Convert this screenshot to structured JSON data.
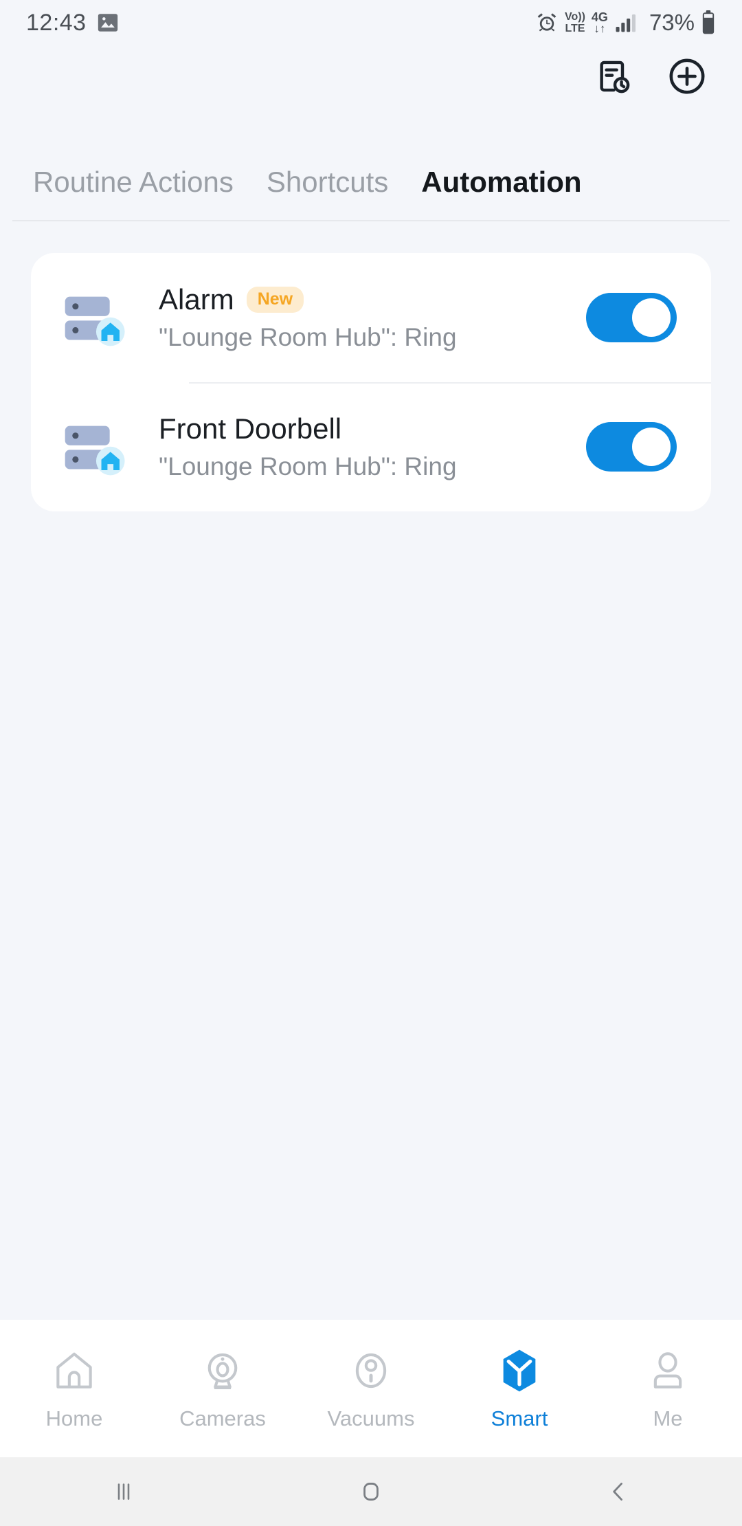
{
  "status_bar": {
    "time": "12:43",
    "battery_percent": "73%",
    "icons": [
      "image-icon",
      "alarm-icon",
      "volte-icon",
      "4g-icon",
      "signal-icon",
      "battery-icon"
    ],
    "volte_top": "Vo))",
    "volte_bottom": "LTE",
    "network_type": "4G",
    "network_arrows": "↓↑"
  },
  "header": {
    "actions": [
      {
        "name": "history-log-icon",
        "label": "Log"
      },
      {
        "name": "add-icon",
        "label": "Add"
      }
    ]
  },
  "tabs": [
    {
      "label": "Routine Actions",
      "active": false
    },
    {
      "label": "Shortcuts",
      "active": false
    },
    {
      "label": "Automation",
      "active": true
    }
  ],
  "automations": [
    {
      "title": "Alarm",
      "badge": "New",
      "subtitle": "\"Lounge Room Hub\": Ring",
      "icon": "hub-device-icon",
      "enabled": true,
      "toggle_state": "on"
    },
    {
      "title": "Front Doorbell",
      "badge": "",
      "subtitle": "\"Lounge Room Hub\": Ring",
      "icon": "hub-device-icon",
      "enabled": true,
      "toggle_state": "on"
    }
  ],
  "bottom_nav": [
    {
      "label": "Home",
      "icon": "home-icon",
      "active": false
    },
    {
      "label": "Cameras",
      "icon": "camera-icon",
      "active": false
    },
    {
      "label": "Vacuums",
      "icon": "vacuum-icon",
      "active": false
    },
    {
      "label": "Smart",
      "icon": "smart-cube-icon",
      "active": true
    },
    {
      "label": "Me",
      "icon": "person-icon",
      "active": false
    }
  ],
  "system_nav": [
    {
      "name": "recents-button",
      "icon": "recents-icon"
    },
    {
      "name": "home-button",
      "icon": "home-square-icon"
    },
    {
      "name": "back-button",
      "icon": "back-chevron-icon"
    }
  ],
  "colors": {
    "background": "#f4f6fa",
    "card": "#ffffff",
    "accent_blue": "#0d8ae0",
    "badge_text": "#f5a623",
    "badge_bg": "#fdeccf",
    "muted_text": "#8a8f96"
  }
}
